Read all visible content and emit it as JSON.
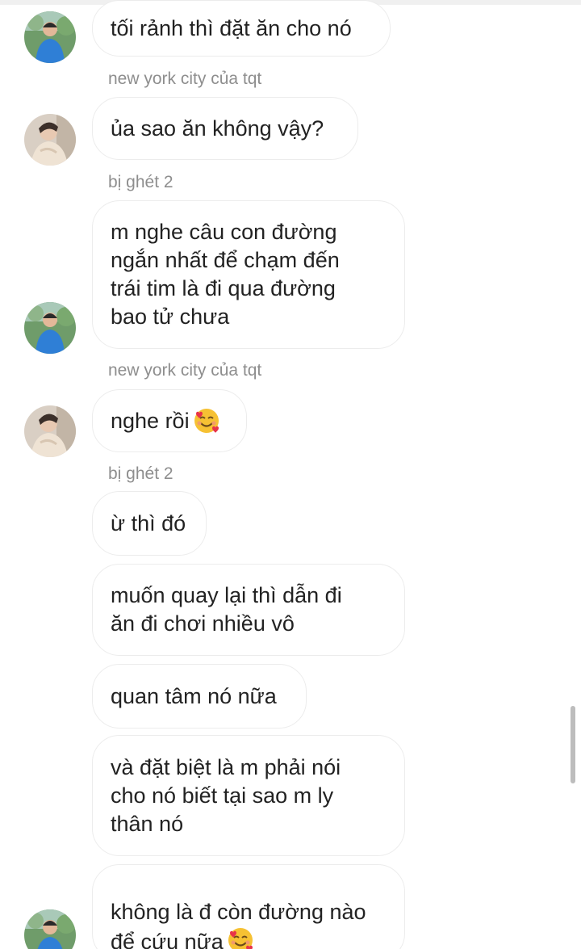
{
  "messages": [
    {
      "text": "tối rảnh thì đặt ăn cho nó"
    },
    {
      "sender": "new york city của tqt",
      "text": "ủa sao ăn không vậy?"
    },
    {
      "sender": "bị ghét 2",
      "text": "m nghe câu con đường\nngắn nhất để chạm đến\ntrái tim là đi qua đường\nbao tử chưa"
    },
    {
      "sender": "new york city của tqt",
      "text": "nghe rồi",
      "emoji": "smiling-face-with-hearts"
    },
    {
      "sender": "bị ghét 2",
      "text": "ừ thì đó"
    },
    {
      "text": "muốn quay lại thì dẫn đi\năn đi chơi nhiều vô"
    },
    {
      "text": "quan tâm nó nữa"
    },
    {
      "text": "và đặt biệt là m phải nói\ncho nó biết tại sao m ly\nthân nó"
    },
    {
      "text": "không là đ còn đường nào\nđể cứu nữa",
      "emoji": "smiling-face-with-hearts"
    }
  ],
  "avatars": [
    {
      "who": "bị ghét 2",
      "style": "outdoor-blue-shirt"
    },
    {
      "who": "new york city của tqt",
      "style": "beige-sweater"
    }
  ],
  "colors": {
    "bubble_border": "#ececec",
    "text": "#222222",
    "sender_label": "#8e8e8e",
    "background": "#ffffff"
  }
}
